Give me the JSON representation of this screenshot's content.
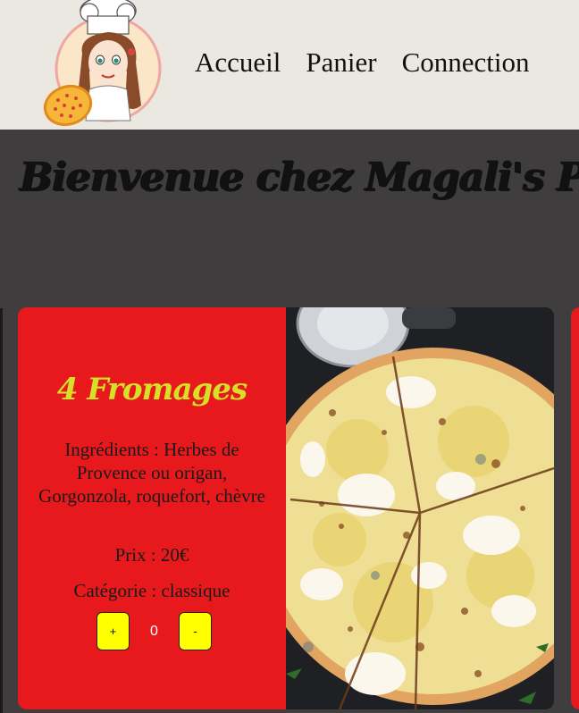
{
  "header": {
    "logo": {
      "icon": "chef-girl-with-pizza-logo"
    },
    "nav": [
      {
        "label": "Accueil"
      },
      {
        "label": "Panier"
      },
      {
        "label": "Connection"
      }
    ]
  },
  "hero": {
    "title": "Bienvenue chez Magali's Pizza Picasso"
  },
  "product": {
    "name": "4 Fromages",
    "ingredients": "Ingrédients : Herbes de Provence ou origan, Gorgonzola, roquefort, chèvre",
    "price": "Prix : 20€",
    "category": "Catégorie : classique",
    "quantity": "0",
    "plus_label": "+",
    "minus_label": "-",
    "image": {
      "icon": "four-cheese-pizza-photo"
    }
  },
  "colors": {
    "header_bg": "#ebe8e1",
    "page_bg": "#3f3d3d",
    "card_red": "#e8191c",
    "title_yellow": "#d6e026",
    "button_yellow": "#ffff00"
  }
}
